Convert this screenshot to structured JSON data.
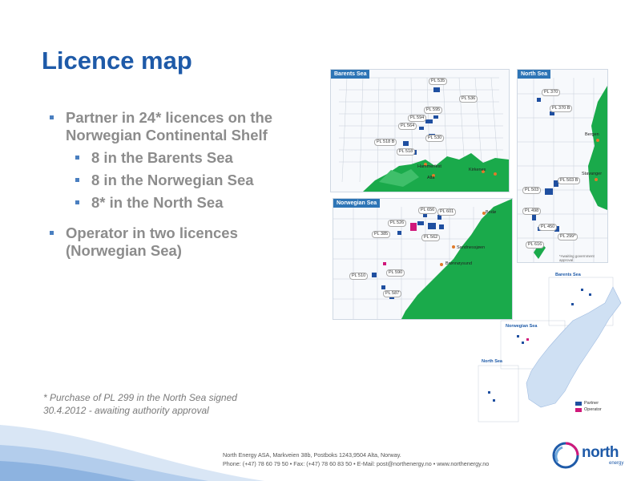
{
  "slide": {
    "title": "Licence map",
    "bullets": {
      "partner": "Partner in 24* licences on the Norwegian Continental Shelf",
      "sub": [
        "8 in the Barents Sea",
        "8 in the Norwegian Sea",
        "8* in the North Sea"
      ],
      "operator": "Operator in two licences (Norwegian Sea)"
    },
    "footnote": [
      "* Purchase of PL 299 in the North Sea signed",
      "30.4.2012 - awaiting authority approval"
    ]
  },
  "footer": {
    "address_line1": "North Energy ASA, Markveien 38b, Postboks 1243,9504 Alta, Norway.",
    "address_line2": "Phone: (+47) 78 60 79 50  • Fax: (+47) 78 60 83 50  • E-Mail: post@northenergy.no • www.northenergy.no",
    "logo_word": "north",
    "logo_sub": "energy"
  },
  "maps": {
    "barents": {
      "label": "Barents Sea",
      "licences": [
        "PL 535",
        "PL 536",
        "PL 595",
        "PL 594",
        "PL 564",
        "PL 530",
        "PL 518 B",
        "PL 518"
      ],
      "places": [
        "Hammerfest",
        "Alta",
        "Kirkenes"
      ]
    },
    "north": {
      "label": "North Sea",
      "licences": [
        "PL 370",
        "PL 370 B",
        "PL 503 B",
        "PL 503",
        "PL 498",
        "PL 450",
        "PL 299*",
        "PL 616"
      ],
      "places": [
        "Bergen",
        "Stavanger"
      ],
      "note": "*Awaiting government approval"
    },
    "norwegian": {
      "label": "Norwegian Sea",
      "licences": [
        "PL 656",
        "PL 601",
        "PL 526",
        "PL 562",
        "PL 385",
        "PL 510",
        "PL 590",
        "PL 587"
      ],
      "places": [
        "Bodø",
        "Sandnessjøen",
        "Brønnøysund"
      ]
    },
    "overview": {
      "labels": [
        "Barents Sea",
        "Norwegian Sea",
        "North Sea"
      ],
      "legend": [
        "Partner",
        "Operator"
      ]
    }
  },
  "colors": {
    "title": "#1e5aa8",
    "bullet_text": "#8c8c8c",
    "bullet_marker": "#4a7fc0",
    "land": "#1aaa4b",
    "partner": "#1f4fa0",
    "operator": "#d0187a",
    "city": "#e07a2a"
  }
}
